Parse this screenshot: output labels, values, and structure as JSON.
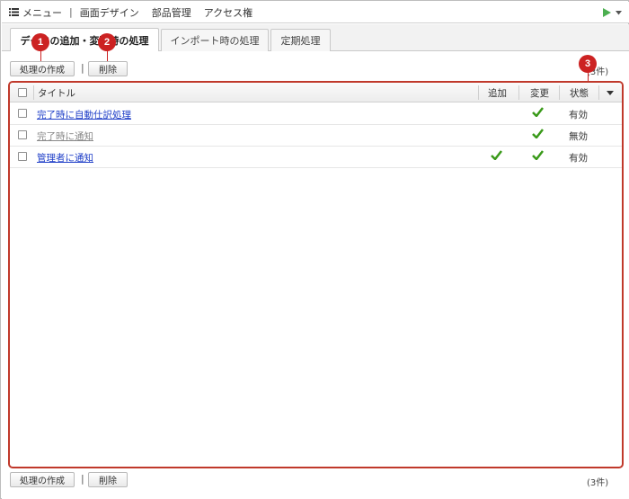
{
  "menubar": {
    "items": [
      "メニュー",
      "画面デザイン",
      "部品管理",
      "アクセス権"
    ],
    "separator": "|"
  },
  "tabs": [
    {
      "label": "データの追加・変更時の処理",
      "active": true
    },
    {
      "label": "インポート時の処理",
      "active": false
    },
    {
      "label": "定期処理",
      "active": false
    }
  ],
  "toolbar": {
    "create_label": "処理の作成",
    "delete_label": "削除",
    "separator": "|",
    "count_label": "(3件)"
  },
  "table": {
    "headers": {
      "title": "タイトル",
      "add": "追加",
      "change": "変更",
      "status": "状態"
    },
    "rows": [
      {
        "title": "完了時に自動仕訳処理",
        "add": false,
        "change": true,
        "status": "有効",
        "enabled": true
      },
      {
        "title": "完了時に通知",
        "add": false,
        "change": true,
        "status": "無効",
        "enabled": false
      },
      {
        "title": "管理者に通知",
        "add": true,
        "change": true,
        "status": "有効",
        "enabled": true
      }
    ]
  },
  "callouts": [
    "1",
    "2",
    "3"
  ],
  "colors": {
    "accent_red": "#cc2222",
    "link_blue": "#2140c8",
    "check_green": "#3a9a1a",
    "play_green": "#4caf50"
  }
}
